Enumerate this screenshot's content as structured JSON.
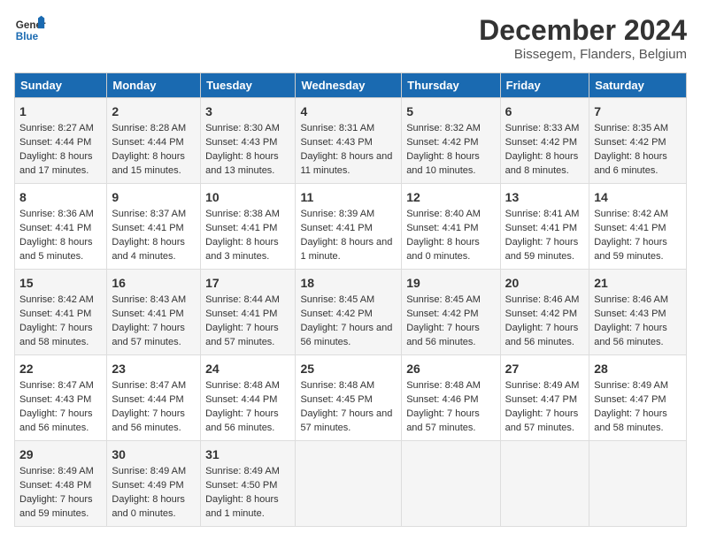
{
  "logo": {
    "line1": "General",
    "line2": "Blue"
  },
  "title": "December 2024",
  "subtitle": "Bissegem, Flanders, Belgium",
  "days_of_week": [
    "Sunday",
    "Monday",
    "Tuesday",
    "Wednesday",
    "Thursday",
    "Friday",
    "Saturday"
  ],
  "weeks": [
    [
      {
        "day": "1",
        "sunrise": "Sunrise: 8:27 AM",
        "sunset": "Sunset: 4:44 PM",
        "daylight": "Daylight: 8 hours and 17 minutes."
      },
      {
        "day": "2",
        "sunrise": "Sunrise: 8:28 AM",
        "sunset": "Sunset: 4:44 PM",
        "daylight": "Daylight: 8 hours and 15 minutes."
      },
      {
        "day": "3",
        "sunrise": "Sunrise: 8:30 AM",
        "sunset": "Sunset: 4:43 PM",
        "daylight": "Daylight: 8 hours and 13 minutes."
      },
      {
        "day": "4",
        "sunrise": "Sunrise: 8:31 AM",
        "sunset": "Sunset: 4:43 PM",
        "daylight": "Daylight: 8 hours and 11 minutes."
      },
      {
        "day": "5",
        "sunrise": "Sunrise: 8:32 AM",
        "sunset": "Sunset: 4:42 PM",
        "daylight": "Daylight: 8 hours and 10 minutes."
      },
      {
        "day": "6",
        "sunrise": "Sunrise: 8:33 AM",
        "sunset": "Sunset: 4:42 PM",
        "daylight": "Daylight: 8 hours and 8 minutes."
      },
      {
        "day": "7",
        "sunrise": "Sunrise: 8:35 AM",
        "sunset": "Sunset: 4:42 PM",
        "daylight": "Daylight: 8 hours and 6 minutes."
      }
    ],
    [
      {
        "day": "8",
        "sunrise": "Sunrise: 8:36 AM",
        "sunset": "Sunset: 4:41 PM",
        "daylight": "Daylight: 8 hours and 5 minutes."
      },
      {
        "day": "9",
        "sunrise": "Sunrise: 8:37 AM",
        "sunset": "Sunset: 4:41 PM",
        "daylight": "Daylight: 8 hours and 4 minutes."
      },
      {
        "day": "10",
        "sunrise": "Sunrise: 8:38 AM",
        "sunset": "Sunset: 4:41 PM",
        "daylight": "Daylight: 8 hours and 3 minutes."
      },
      {
        "day": "11",
        "sunrise": "Sunrise: 8:39 AM",
        "sunset": "Sunset: 4:41 PM",
        "daylight": "Daylight: 8 hours and 1 minute."
      },
      {
        "day": "12",
        "sunrise": "Sunrise: 8:40 AM",
        "sunset": "Sunset: 4:41 PM",
        "daylight": "Daylight: 8 hours and 0 minutes."
      },
      {
        "day": "13",
        "sunrise": "Sunrise: 8:41 AM",
        "sunset": "Sunset: 4:41 PM",
        "daylight": "Daylight: 7 hours and 59 minutes."
      },
      {
        "day": "14",
        "sunrise": "Sunrise: 8:42 AM",
        "sunset": "Sunset: 4:41 PM",
        "daylight": "Daylight: 7 hours and 59 minutes."
      }
    ],
    [
      {
        "day": "15",
        "sunrise": "Sunrise: 8:42 AM",
        "sunset": "Sunset: 4:41 PM",
        "daylight": "Daylight: 7 hours and 58 minutes."
      },
      {
        "day": "16",
        "sunrise": "Sunrise: 8:43 AM",
        "sunset": "Sunset: 4:41 PM",
        "daylight": "Daylight: 7 hours and 57 minutes."
      },
      {
        "day": "17",
        "sunrise": "Sunrise: 8:44 AM",
        "sunset": "Sunset: 4:41 PM",
        "daylight": "Daylight: 7 hours and 57 minutes."
      },
      {
        "day": "18",
        "sunrise": "Sunrise: 8:45 AM",
        "sunset": "Sunset: 4:42 PM",
        "daylight": "Daylight: 7 hours and 56 minutes."
      },
      {
        "day": "19",
        "sunrise": "Sunrise: 8:45 AM",
        "sunset": "Sunset: 4:42 PM",
        "daylight": "Daylight: 7 hours and 56 minutes."
      },
      {
        "day": "20",
        "sunrise": "Sunrise: 8:46 AM",
        "sunset": "Sunset: 4:42 PM",
        "daylight": "Daylight: 7 hours and 56 minutes."
      },
      {
        "day": "21",
        "sunrise": "Sunrise: 8:46 AM",
        "sunset": "Sunset: 4:43 PM",
        "daylight": "Daylight: 7 hours and 56 minutes."
      }
    ],
    [
      {
        "day": "22",
        "sunrise": "Sunrise: 8:47 AM",
        "sunset": "Sunset: 4:43 PM",
        "daylight": "Daylight: 7 hours and 56 minutes."
      },
      {
        "day": "23",
        "sunrise": "Sunrise: 8:47 AM",
        "sunset": "Sunset: 4:44 PM",
        "daylight": "Daylight: 7 hours and 56 minutes."
      },
      {
        "day": "24",
        "sunrise": "Sunrise: 8:48 AM",
        "sunset": "Sunset: 4:44 PM",
        "daylight": "Daylight: 7 hours and 56 minutes."
      },
      {
        "day": "25",
        "sunrise": "Sunrise: 8:48 AM",
        "sunset": "Sunset: 4:45 PM",
        "daylight": "Daylight: 7 hours and 57 minutes."
      },
      {
        "day": "26",
        "sunrise": "Sunrise: 8:48 AM",
        "sunset": "Sunset: 4:46 PM",
        "daylight": "Daylight: 7 hours and 57 minutes."
      },
      {
        "day": "27",
        "sunrise": "Sunrise: 8:49 AM",
        "sunset": "Sunset: 4:47 PM",
        "daylight": "Daylight: 7 hours and 57 minutes."
      },
      {
        "day": "28",
        "sunrise": "Sunrise: 8:49 AM",
        "sunset": "Sunset: 4:47 PM",
        "daylight": "Daylight: 7 hours and 58 minutes."
      }
    ],
    [
      {
        "day": "29",
        "sunrise": "Sunrise: 8:49 AM",
        "sunset": "Sunset: 4:48 PM",
        "daylight": "Daylight: 7 hours and 59 minutes."
      },
      {
        "day": "30",
        "sunrise": "Sunrise: 8:49 AM",
        "sunset": "Sunset: 4:49 PM",
        "daylight": "Daylight: 8 hours and 0 minutes."
      },
      {
        "day": "31",
        "sunrise": "Sunrise: 8:49 AM",
        "sunset": "Sunset: 4:50 PM",
        "daylight": "Daylight: 8 hours and 1 minute."
      },
      null,
      null,
      null,
      null
    ]
  ]
}
